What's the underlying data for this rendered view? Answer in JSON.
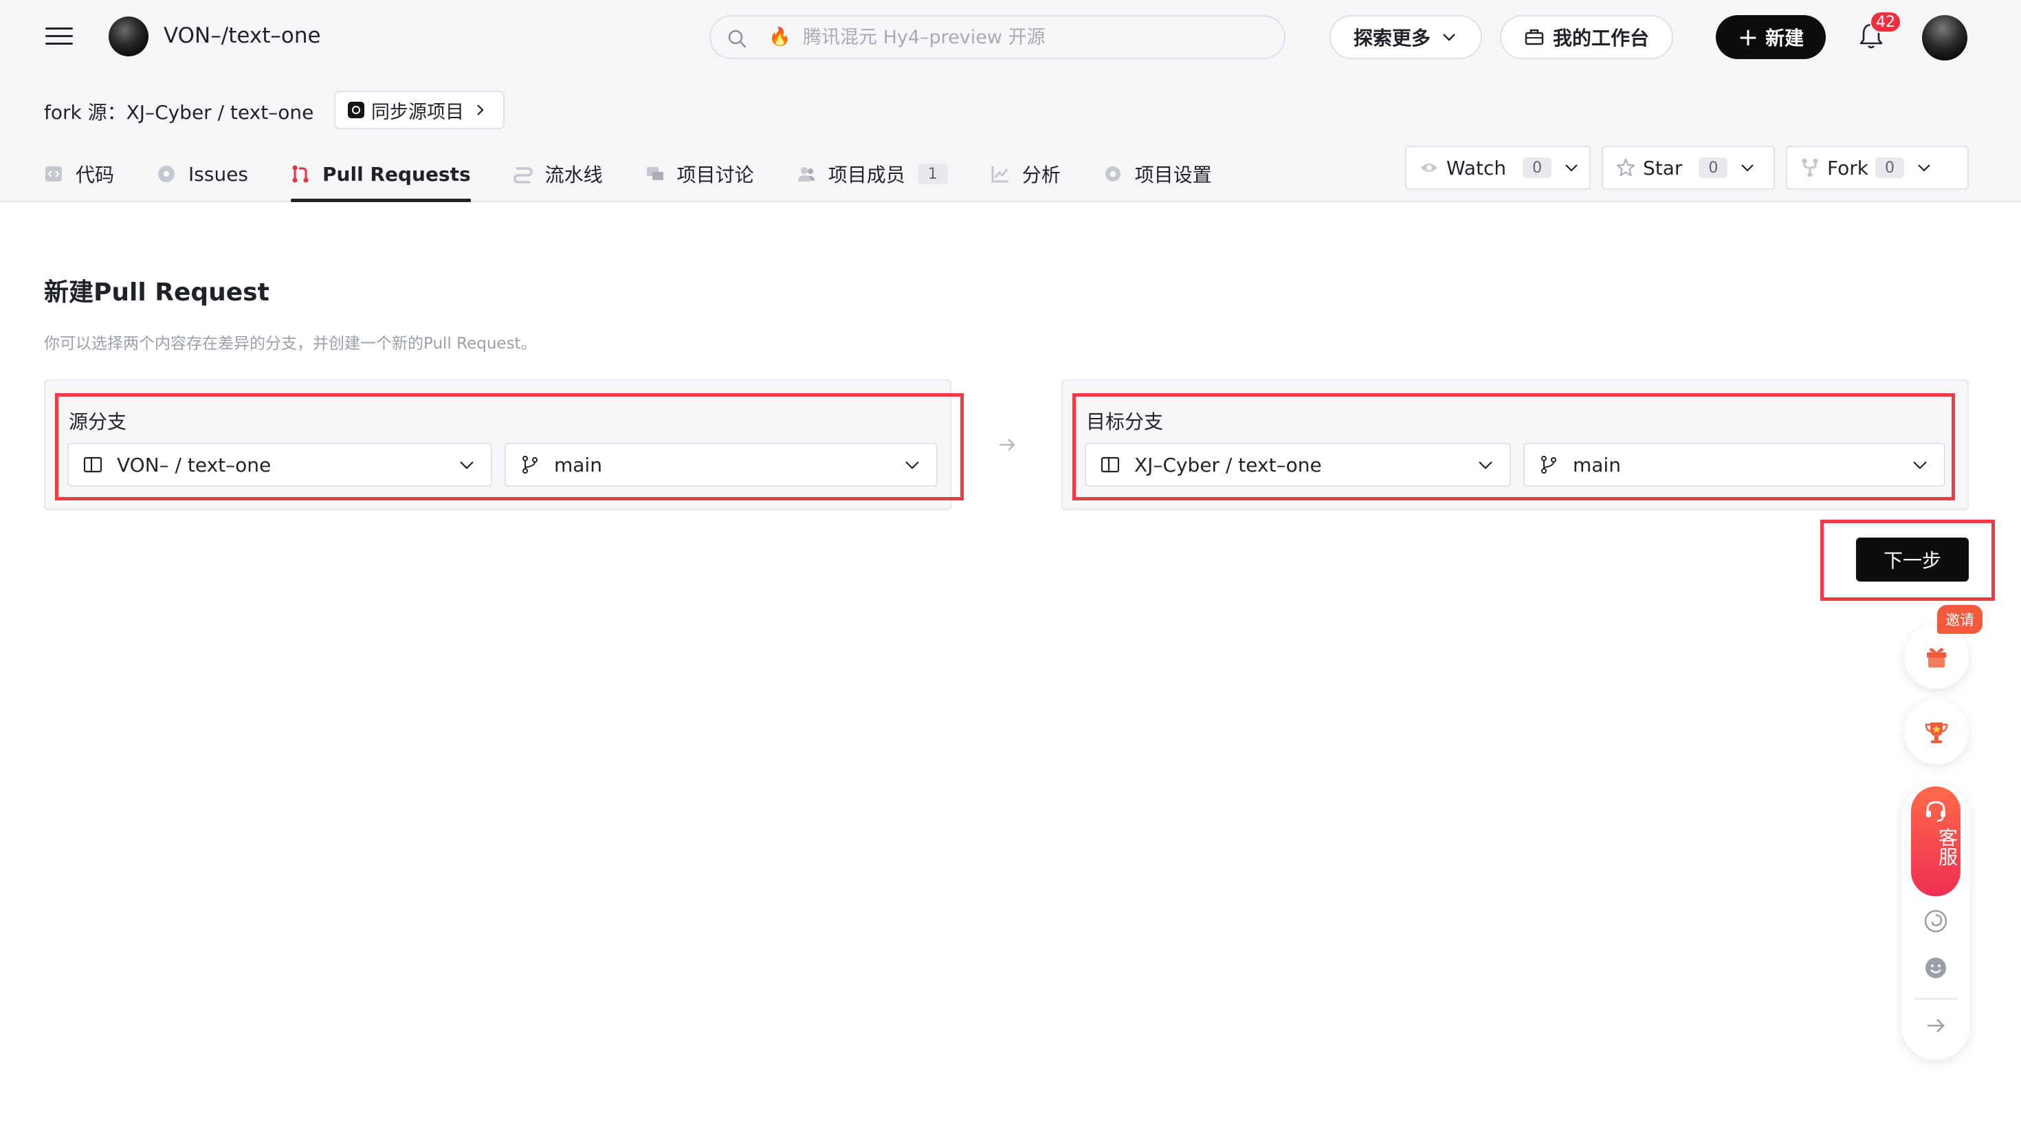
{
  "topbar": {
    "repo_title": "VON–/text–one",
    "search_placeholder": "腾讯混元 Hy4–preview 开源",
    "explore_label": "探索更多",
    "workbench_label": "我的工作台",
    "new_label": "新建",
    "notification_count": "42"
  },
  "repo_header": {
    "fork_prefix": "fork 源：",
    "fork_source": "XJ–Cyber / text–one",
    "sync_label": "同步源项目",
    "tabs": [
      {
        "label": "代码"
      },
      {
        "label": "Issues"
      },
      {
        "label": "Pull Requests"
      },
      {
        "label": "流水线"
      },
      {
        "label": "项目讨论"
      },
      {
        "label": "项目成员",
        "count": "1"
      },
      {
        "label": "分析"
      },
      {
        "label": "项目设置"
      }
    ],
    "watch": {
      "label": "Watch",
      "count": "0"
    },
    "star": {
      "label": "Star",
      "count": "0"
    },
    "fork": {
      "label": "Fork",
      "count": "0"
    }
  },
  "main": {
    "title": "新建Pull Request",
    "description": "你可以选择两个内容存在差异的分支，并创建一个新的Pull Request。",
    "source": {
      "label": "源分支",
      "repo": "VON– / text–one",
      "branch": "main"
    },
    "target": {
      "label": "目标分支",
      "repo": "XJ–Cyber / text–one",
      "branch": "main"
    },
    "next_label": "下一步"
  },
  "floating": {
    "invite_label": "邀请",
    "customer_service_label": "客服"
  },
  "colors": {
    "accent_dark": "#0d0d0d",
    "highlight_red": "#ee3b45",
    "badge_red": "#ee2f40",
    "pr_icon_red": "#e5323e"
  }
}
